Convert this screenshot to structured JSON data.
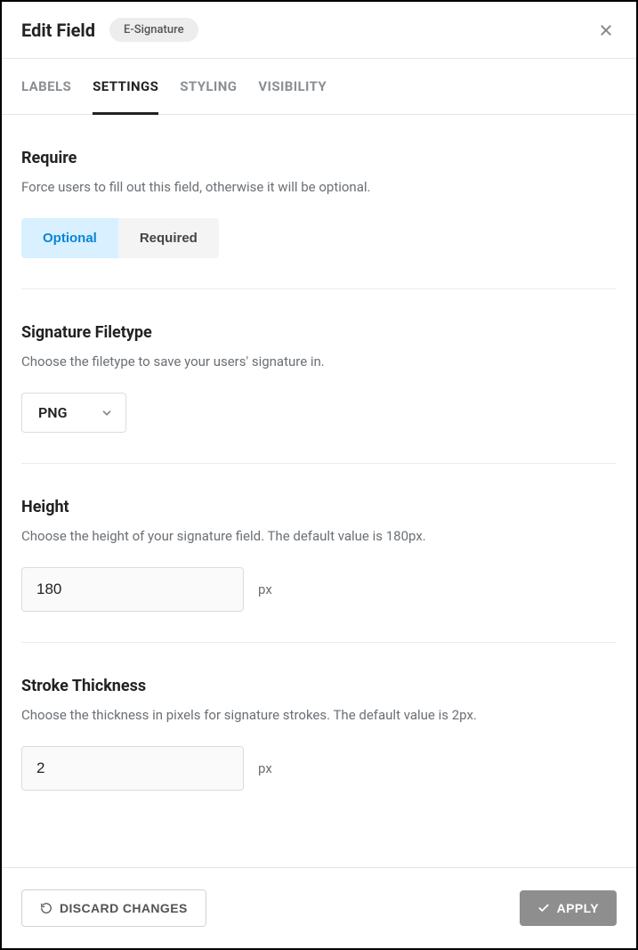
{
  "header": {
    "title": "Edit Field",
    "badge": "E-Signature"
  },
  "tabs": {
    "labels": {
      "label": "LABELS"
    },
    "settings": {
      "label": "SETTINGS"
    },
    "styling": {
      "label": "STYLING"
    },
    "visibility": {
      "label": "VISIBILITY"
    },
    "active": "settings"
  },
  "sections": {
    "require": {
      "title": "Require",
      "desc": "Force users to fill out this field, otherwise it will be optional.",
      "options": {
        "optional": "Optional",
        "required": "Required"
      },
      "selected": "optional"
    },
    "filetype": {
      "title": "Signature Filetype",
      "desc": "Choose the filetype to save your users' signature in.",
      "value": "PNG"
    },
    "height": {
      "title": "Height",
      "desc": "Choose the height of your signature field. The default value is 180px.",
      "value": "180",
      "unit": "px"
    },
    "stroke": {
      "title": "Stroke Thickness",
      "desc": "Choose the thickness in pixels for signature strokes. The default value is 2px.",
      "value": "2",
      "unit": "px"
    }
  },
  "footer": {
    "discard": "DISCARD CHANGES",
    "apply": "APPLY"
  }
}
